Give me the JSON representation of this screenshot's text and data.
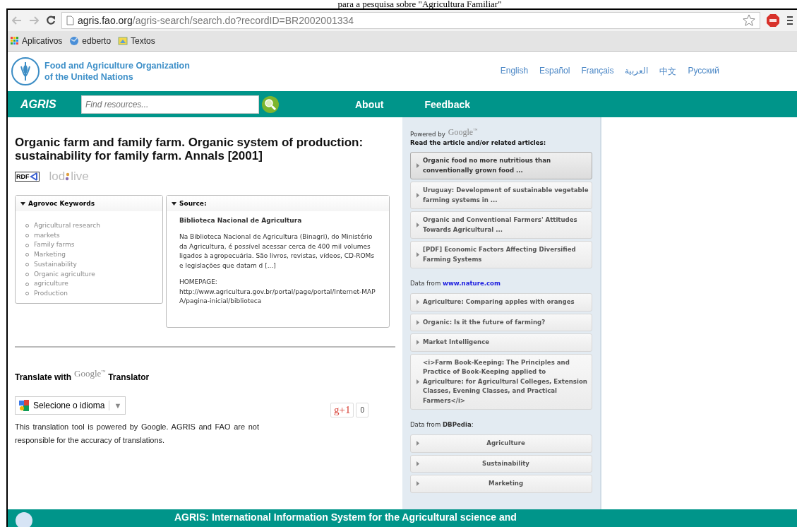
{
  "caption": "para a pesquisa sobre \"Agricultura Familiar\"",
  "browser": {
    "url_host": "agris.fao.org",
    "url_path": "/agris-search/search.do?recordID=BR2002001334",
    "bookmarks": [
      "Aplicativos",
      "edberto",
      "Textos"
    ]
  },
  "header": {
    "org_line1": "Food and Agriculture Organization",
    "org_line2": "of the United Nations",
    "languages": [
      "English",
      "Español",
      "Français",
      "العربية",
      "中文",
      "Русский"
    ]
  },
  "nav": {
    "brand": "AGRIS",
    "search_placeholder": "Find resources...",
    "links": [
      "About",
      "Feedback"
    ]
  },
  "record": {
    "title": "Organic farm and family farm. Organic system of production: sustainability for family farm. Annals  [2001]",
    "rdf": "RDF",
    "lod": "lod",
    "live": "live"
  },
  "keywords": {
    "heading": "Agrovoc Keywords",
    "expanded": true,
    "items": [
      "Agricultural research",
      "markets",
      "Family farms",
      "Marketing",
      "Sustainability",
      "Organic agriculture",
      "agriculture",
      "Production"
    ]
  },
  "source": {
    "heading": "Source:",
    "expanded": true,
    "name": "Biblioteca Nacional de Agricultura",
    "description": "Na Biblioteca Nacional de Agricultura (Binagri), do Ministério da Agricultura, é possível acessar cerca de 400 mil volumes ligados à agropecuária. São livros, revistas, vídeos, CD-ROMs e legislações que datam d [...]",
    "homepage_label": "HOMEPAGE:",
    "homepage_url": "http://www.agricultura.gov.br/portal/page/portal/Internet-MAPA/pagina-inicial/biblioteca"
  },
  "translate": {
    "prefix": "Translate with",
    "google": "Google",
    "tm": "™",
    "suffix": "Translator",
    "select": "Selecione o idioma",
    "arrow": "▼",
    "disclaimer": "This translation tool is powered by Google. AGRIS and FAO are not responsible for the accuracy of translations.",
    "plus": "g+1",
    "count": "0"
  },
  "sidebar": {
    "powered_by": "Powered by",
    "google": "Google",
    "tm": "™",
    "read_heading": "Read the article and/or related articles:",
    "articles": [
      {
        "title": "Organic food no more nutritious than conventionally grown food ...",
        "selected": true
      },
      {
        "title": "Uruguay: Development of sustainable vegetable farming systems in ...",
        "selected": false
      },
      {
        "title": "Organic and Conventional Farmers' Attitudes Towards Agricultural ...",
        "selected": false
      },
      {
        "title": "[PDF] Economic Factors Affecting Diversified Farming Systems",
        "selected": false
      }
    ],
    "nature_prefix": "Data from",
    "nature_link": "www.nature.com",
    "nature_items": [
      "Agriculture: Comparing apples with oranges",
      "Organic: Is it the future of farming?",
      "Market Intelligence",
      "<i>Farm Book-Keeping: The Principles and Practice of Book-Keeping applied to Agriculture: for Agricultural Colleges, Extension Classes, Evening Classes, and Practical Farmers</i>"
    ],
    "dbpedia_prefix": "Data from",
    "dbpedia_name": "DBPedia",
    "dbpedia_colon": ":",
    "dbpedia_items": [
      "Agriculture",
      "Sustainability",
      "Marketing"
    ]
  },
  "footer": {
    "title": "AGRIS: International Information System for the Agricultural science and"
  }
}
